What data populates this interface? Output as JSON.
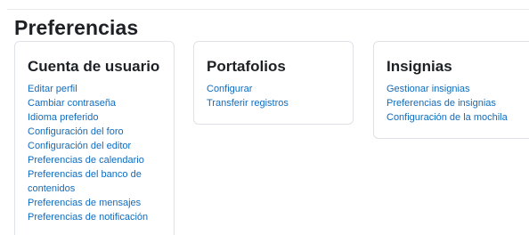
{
  "page": {
    "title": "Preferencias"
  },
  "cards": {
    "user": {
      "title": "Cuenta de usuario",
      "links": [
        "Editar perfil",
        "Cambiar contraseña",
        "Idioma preferido",
        "Configuración del foro",
        "Configuración del editor",
        "Preferencias de calendario",
        "Preferencias del banco de contenidos",
        "Preferencias de mensajes",
        "Preferencias de notificación"
      ]
    },
    "portfolio": {
      "title": "Portafolios",
      "links": [
        "Configurar",
        "Transferir registros"
      ]
    },
    "badges": {
      "title": "Insignias",
      "links": [
        "Gestionar insignias",
        "Preferencias de insignias",
        "Configuración de la mochila"
      ]
    }
  },
  "colors": {
    "link": "#0f6cbf",
    "heading": "#1d2125",
    "card_border": "#dee2e6"
  }
}
